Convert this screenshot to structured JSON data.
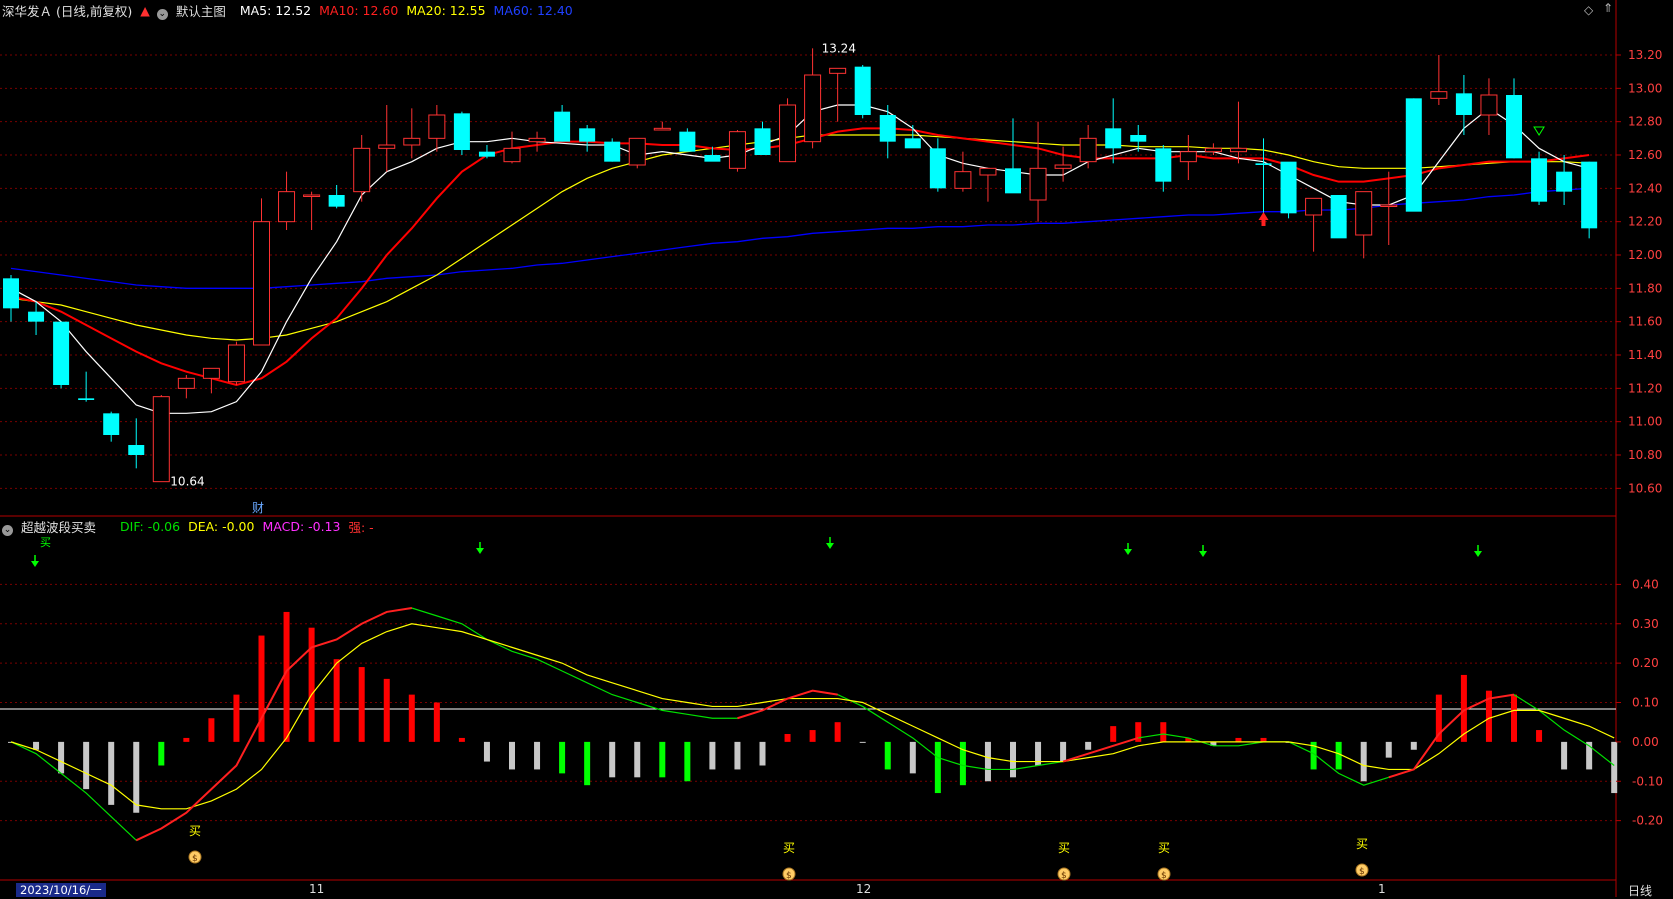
{
  "header": {
    "stock_title": "深华发Ａ (日线,前复权)",
    "main_chart_label": "默认主图",
    "ma5_label": "MA5: 12.52",
    "ma10_label": "MA10: 12.60",
    "ma20_label": "MA20: 12.55",
    "ma60_label": "MA60: 12.40"
  },
  "indicator_header": {
    "name": "超越波段买卖",
    "dif_label": "DIF: -0.06",
    "dea_label": "DEA: -0.00",
    "macd_label": "MACD: -0.13",
    "strong_label": "强: -"
  },
  "colors": {
    "up": "#ff3232",
    "down": "#00ffff",
    "ma5": "#ffffff",
    "ma10": "#ff0000",
    "ma20": "#ffff00",
    "ma60": "#0000ff",
    "dif": "#00e000",
    "dea": "#ffff00",
    "macd_pos": "#ff0000",
    "macd_neg": "#c8c8c8",
    "signal_green": "#00ff00"
  },
  "price_axis_ticks": [
    "13.20",
    "13.00",
    "12.80",
    "12.60",
    "12.40",
    "12.20",
    "12.00",
    "11.80",
    "11.60",
    "11.40",
    "11.20",
    "11.00",
    "10.80",
    "10.60"
  ],
  "macd_axis_ticks": [
    "0.40",
    "0.30",
    "0.20",
    "0.10",
    "0.00",
    "-0.10",
    "-0.20"
  ],
  "annotations": {
    "high": "13.24",
    "low": "10.64",
    "fin": "财",
    "buy": "买",
    "sell_top": "买"
  },
  "date_axis": {
    "start_label": "2023/10/16/一",
    "m11": "11",
    "m12": "12",
    "m1": "1"
  },
  "bottom_tab": "日线",
  "chart_data": {
    "type": "candlestick",
    "title": "深华发Ａ (日线,前复权)",
    "ylim": [
      10.5,
      13.35
    ],
    "candles": [
      [
        11.86,
        11.88,
        11.6,
        11.68
      ],
      [
        11.66,
        11.72,
        11.52,
        11.6
      ],
      [
        11.6,
        11.6,
        11.2,
        11.22
      ],
      [
        11.14,
        11.3,
        11.12,
        11.13
      ],
      [
        11.05,
        11.06,
        10.88,
        10.92
      ],
      [
        10.86,
        11.02,
        10.72,
        10.8
      ],
      [
        10.64,
        11.16,
        10.64,
        11.15
      ],
      [
        11.2,
        11.28,
        11.14,
        11.26
      ],
      [
        11.26,
        11.32,
        11.17,
        11.32
      ],
      [
        11.24,
        11.48,
        11.22,
        11.46
      ],
      [
        11.46,
        12.34,
        11.46,
        12.2
      ],
      [
        12.2,
        12.5,
        12.15,
        12.38
      ],
      [
        12.36,
        12.38,
        12.15,
        12.36
      ],
      [
        12.36,
        12.42,
        12.28,
        12.29
      ],
      [
        12.38,
        12.72,
        12.32,
        12.64
      ],
      [
        12.64,
        12.9,
        12.5,
        12.66
      ],
      [
        12.66,
        12.88,
        12.58,
        12.7
      ],
      [
        12.7,
        12.9,
        12.62,
        12.84
      ],
      [
        12.85,
        12.86,
        12.6,
        12.63
      ],
      [
        12.62,
        12.66,
        12.58,
        12.59
      ],
      [
        12.56,
        12.74,
        12.55,
        12.64
      ],
      [
        12.68,
        12.74,
        12.62,
        12.7
      ],
      [
        12.86,
        12.9,
        12.68,
        12.68
      ],
      [
        12.76,
        12.78,
        12.62,
        12.68
      ],
      [
        12.68,
        12.7,
        12.56,
        12.56
      ],
      [
        12.54,
        12.7,
        12.52,
        12.7
      ],
      [
        12.75,
        12.8,
        12.75,
        12.76
      ],
      [
        12.74,
        12.76,
        12.64,
        12.62
      ],
      [
        12.6,
        12.65,
        12.58,
        12.56
      ],
      [
        12.52,
        12.75,
        12.5,
        12.74
      ],
      [
        12.76,
        12.8,
        12.66,
        12.6
      ],
      [
        12.56,
        12.94,
        12.62,
        12.9
      ],
      [
        12.68,
        13.24,
        12.64,
        13.08
      ],
      [
        13.09,
        13.12,
        12.8,
        13.12
      ],
      [
        13.13,
        13.14,
        12.82,
        12.84
      ],
      [
        12.84,
        12.9,
        12.58,
        12.68
      ],
      [
        12.7,
        12.78,
        12.66,
        12.64
      ],
      [
        12.64,
        12.7,
        12.38,
        12.4
      ],
      [
        12.4,
        12.62,
        12.38,
        12.5
      ],
      [
        12.48,
        12.52,
        12.32,
        12.52
      ],
      [
        12.52,
        12.82,
        12.4,
        12.37
      ],
      [
        12.33,
        12.8,
        12.2,
        12.52
      ],
      [
        12.52,
        12.65,
        12.44,
        12.54
      ],
      [
        12.56,
        12.78,
        12.52,
        12.7
      ],
      [
        12.76,
        12.94,
        12.55,
        12.64
      ],
      [
        12.72,
        12.78,
        12.62,
        12.68
      ],
      [
        12.64,
        12.66,
        12.38,
        12.44
      ],
      [
        12.56,
        12.72,
        12.45,
        12.62
      ],
      [
        12.62,
        12.67,
        12.6,
        12.64
      ],
      [
        12.62,
        12.92,
        12.55,
        12.64
      ],
      [
        12.55,
        12.7,
        12.22,
        12.54
      ],
      [
        12.56,
        12.52,
        12.22,
        12.25
      ],
      [
        12.24,
        12.32,
        12.02,
        12.34
      ],
      [
        12.36,
        12.32,
        12.12,
        12.1
      ],
      [
        12.12,
        12.38,
        11.98,
        12.38
      ],
      [
        12.3,
        12.5,
        12.06,
        12.3
      ],
      [
        12.94,
        12.94,
        12.32,
        12.26
      ],
      [
        12.94,
        13.2,
        12.9,
        12.98
      ],
      [
        12.97,
        13.08,
        12.72,
        12.84
      ],
      [
        12.84,
        13.06,
        12.72,
        12.96
      ],
      [
        12.96,
        13.06,
        12.58,
        12.58
      ],
      [
        12.58,
        12.62,
        12.3,
        12.32
      ],
      [
        12.5,
        12.6,
        12.3,
        12.38
      ],
      [
        12.56,
        12.56,
        12.1,
        12.16
      ]
    ],
    "ma5": [
      11.8,
      11.72,
      11.6,
      11.42,
      11.26,
      11.1,
      11.05,
      11.05,
      11.06,
      11.12,
      11.3,
      11.6,
      11.86,
      12.08,
      12.36,
      12.5,
      12.56,
      12.64,
      12.68,
      12.68,
      12.7,
      12.68,
      12.67,
      12.66,
      12.66,
      12.6,
      12.62,
      12.6,
      12.58,
      12.6,
      12.66,
      12.72,
      12.86,
      12.9,
      12.9,
      12.86,
      12.76,
      12.6,
      12.55,
      12.52,
      12.5,
      12.48,
      12.48,
      12.56,
      12.6,
      12.64,
      12.62,
      12.62,
      12.62,
      12.58,
      12.56,
      12.48,
      12.4,
      12.32,
      12.3,
      12.3,
      12.36,
      12.56,
      12.76,
      12.88,
      12.78,
      12.64,
      12.56,
      12.52
    ],
    "ma10": [
      11.75,
      11.72,
      11.66,
      11.58,
      11.5,
      11.42,
      11.35,
      11.3,
      11.26,
      11.22,
      11.26,
      11.36,
      11.5,
      11.62,
      11.8,
      12.0,
      12.16,
      12.34,
      12.5,
      12.6,
      12.64,
      12.66,
      12.68,
      12.68,
      12.67,
      12.67,
      12.66,
      12.66,
      12.64,
      12.63,
      12.64,
      12.66,
      12.7,
      12.74,
      12.76,
      12.76,
      12.75,
      12.72,
      12.7,
      12.68,
      12.66,
      12.64,
      12.6,
      12.58,
      12.58,
      12.58,
      12.58,
      12.6,
      12.58,
      12.58,
      12.58,
      12.54,
      12.48,
      12.44,
      12.44,
      12.46,
      12.48,
      12.52,
      12.54,
      12.56,
      12.56,
      12.56,
      12.58,
      12.6
    ],
    "ma20": [
      11.74,
      11.72,
      11.7,
      11.66,
      11.62,
      11.58,
      11.55,
      11.52,
      11.5,
      11.49,
      11.5,
      11.52,
      11.56,
      11.6,
      11.66,
      11.72,
      11.8,
      11.88,
      11.98,
      12.08,
      12.18,
      12.28,
      12.38,
      12.46,
      12.52,
      12.56,
      12.6,
      12.62,
      12.64,
      12.66,
      12.68,
      12.7,
      12.72,
      12.72,
      12.72,
      12.72,
      12.72,
      12.71,
      12.7,
      12.69,
      12.68,
      12.67,
      12.66,
      12.66,
      12.66,
      12.65,
      12.65,
      12.65,
      12.64,
      12.64,
      12.63,
      12.6,
      12.56,
      12.53,
      12.52,
      12.52,
      12.52,
      12.53,
      12.54,
      12.55,
      12.56,
      12.56,
      12.56,
      12.55
    ],
    "ma60": [
      11.92,
      11.9,
      11.88,
      11.86,
      11.84,
      11.82,
      11.81,
      11.8,
      11.8,
      11.8,
      11.8,
      11.81,
      11.82,
      11.83,
      11.84,
      11.86,
      11.87,
      11.88,
      11.9,
      11.91,
      11.92,
      11.94,
      11.95,
      11.97,
      11.99,
      12.01,
      12.03,
      12.05,
      12.07,
      12.08,
      12.1,
      12.11,
      12.13,
      12.14,
      12.15,
      12.16,
      12.16,
      12.17,
      12.17,
      12.18,
      12.18,
      12.19,
      12.19,
      12.2,
      12.21,
      12.22,
      12.23,
      12.24,
      12.24,
      12.25,
      12.26,
      12.26,
      12.27,
      12.27,
      12.28,
      12.3,
      12.31,
      12.32,
      12.33,
      12.35,
      12.36,
      12.38,
      12.39,
      12.4
    ],
    "macd": {
      "ylim": [
        -0.3,
        0.5
      ],
      "hist": [
        0.0,
        -0.02,
        -0.08,
        -0.12,
        -0.16,
        -0.18,
        -0.06,
        0.01,
        0.06,
        0.12,
        0.27,
        0.33,
        0.29,
        0.21,
        0.19,
        0.16,
        0.12,
        0.1,
        0.01,
        -0.05,
        -0.07,
        -0.07,
        -0.08,
        -0.11,
        -0.09,
        -0.09,
        -0.09,
        -0.1,
        -0.07,
        -0.07,
        -0.06,
        0.02,
        0.03,
        0.05,
        0.0,
        -0.07,
        -0.08,
        -0.13,
        -0.11,
        -0.1,
        -0.09,
        -0.06,
        -0.05,
        -0.02,
        0.04,
        0.05,
        0.05,
        0.01,
        -0.01,
        0.01,
        0.01,
        0.0,
        -0.07,
        -0.07,
        -0.1,
        -0.04,
        -0.02,
        0.12,
        0.17,
        0.13,
        0.12,
        0.03,
        -0.07,
        -0.07,
        -0.13
      ],
      "dif": [
        0.0,
        -0.03,
        -0.08,
        -0.13,
        -0.19,
        -0.25,
        -0.22,
        -0.18,
        -0.12,
        -0.06,
        0.06,
        0.18,
        0.24,
        0.26,
        0.3,
        0.33,
        0.34,
        0.32,
        0.3,
        0.26,
        0.23,
        0.21,
        0.18,
        0.15,
        0.12,
        0.1,
        0.08,
        0.07,
        0.06,
        0.06,
        0.08,
        0.11,
        0.13,
        0.12,
        0.09,
        0.05,
        0.01,
        -0.04,
        -0.06,
        -0.07,
        -0.07,
        -0.06,
        -0.05,
        -0.03,
        -0.01,
        0.01,
        0.02,
        0.01,
        -0.01,
        -0.01,
        0.0,
        0.0,
        -0.03,
        -0.08,
        -0.11,
        -0.09,
        -0.07,
        0.02,
        0.08,
        0.11,
        0.12,
        0.08,
        0.03,
        -0.01,
        -0.06
      ],
      "dea": [
        0.0,
        -0.02,
        -0.05,
        -0.08,
        -0.11,
        -0.16,
        -0.17,
        -0.17,
        -0.15,
        -0.12,
        -0.07,
        0.01,
        0.12,
        0.2,
        0.25,
        0.28,
        0.3,
        0.29,
        0.28,
        0.26,
        0.24,
        0.22,
        0.2,
        0.17,
        0.15,
        0.13,
        0.11,
        0.1,
        0.09,
        0.09,
        0.1,
        0.11,
        0.11,
        0.11,
        0.1,
        0.07,
        0.04,
        0.01,
        -0.02,
        -0.04,
        -0.05,
        -0.05,
        -0.05,
        -0.04,
        -0.03,
        -0.01,
        0.0,
        0.0,
        0.0,
        0.0,
        0.0,
        0.0,
        -0.01,
        -0.03,
        -0.06,
        -0.07,
        -0.07,
        -0.03,
        0.02,
        0.06,
        0.08,
        0.08,
        0.06,
        0.04,
        0.01
      ]
    }
  }
}
